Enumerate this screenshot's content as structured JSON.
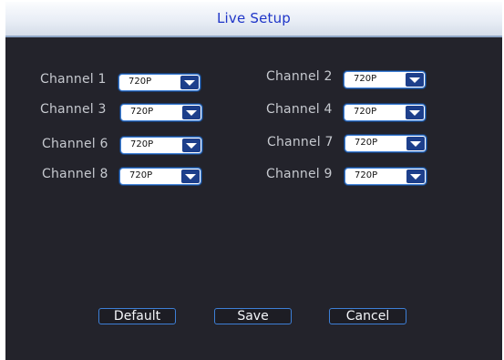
{
  "dialog": {
    "title": "Live Setup"
  },
  "channels": [
    {
      "label": "Channel 1",
      "value": "720P"
    },
    {
      "label": "Channel 2",
      "value": "720P"
    },
    {
      "label": "Channel 3",
      "value": "720P"
    },
    {
      "label": "Channel 4",
      "value": "720P"
    },
    {
      "label": "Channel 6",
      "value": "720P"
    },
    {
      "label": "Channel 7",
      "value": "720P"
    },
    {
      "label": "Channel 8",
      "value": "720P"
    },
    {
      "label": "Channel 9",
      "value": "720P"
    }
  ],
  "buttons": {
    "default": "Default",
    "save": "Save",
    "cancel": "Cancel"
  },
  "icons": {
    "dropdown": "chevron-down-icon"
  },
  "colors": {
    "title": "#1f36c8",
    "panel_background": "#23232b",
    "accent_border": "#3d7fd6",
    "dropdown_arrow_background": "#1d3f8b",
    "label_text": "#c6c9cf"
  }
}
